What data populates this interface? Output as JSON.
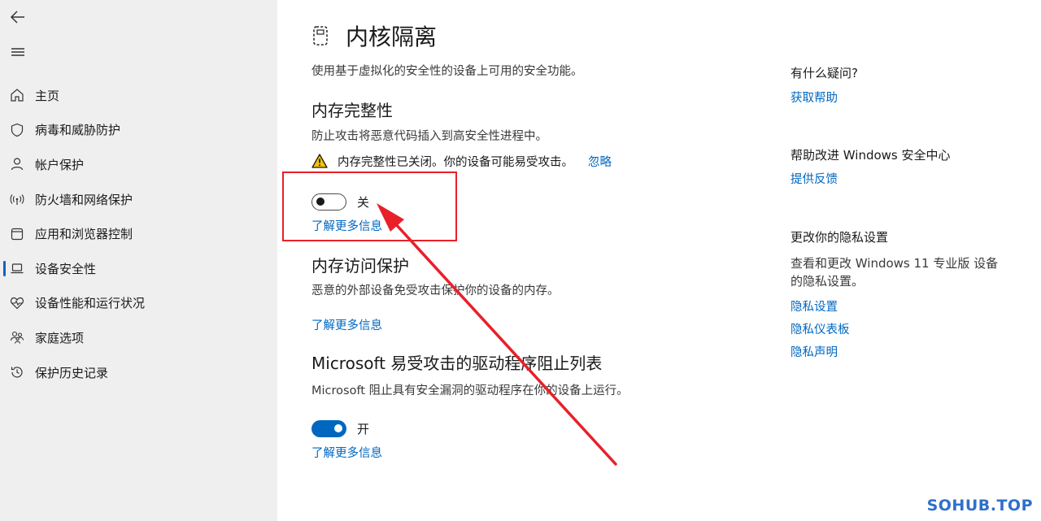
{
  "colors": {
    "accent": "#0067c0",
    "sidebar_bg": "#efefef",
    "annotation": "#e8202a"
  },
  "sidebar": {
    "back_icon": "back-arrow-icon",
    "menu_icon": "hamburger-menu-icon",
    "items": [
      {
        "label": "主页",
        "icon": "home-icon"
      },
      {
        "label": "病毒和威胁防护",
        "icon": "shield-icon"
      },
      {
        "label": "帐户保护",
        "icon": "person-icon"
      },
      {
        "label": "防火墙和网络保护",
        "icon": "wifi-antenna-icon"
      },
      {
        "label": "应用和浏览器控制",
        "icon": "app-window-icon"
      },
      {
        "label": "设备安全性",
        "icon": "laptop-icon"
      },
      {
        "label": "设备性能和运行状况",
        "icon": "heart-pulse-icon"
      },
      {
        "label": "家庭选项",
        "icon": "family-icon"
      },
      {
        "label": "保护历史记录",
        "icon": "history-icon"
      }
    ],
    "active_index": 5
  },
  "main": {
    "title": "内核隔离",
    "title_icon": "core-isolation-chip-icon",
    "description": "使用基于虚拟化的安全性的设备上可用的安全功能。",
    "memory_integrity": {
      "title": "内存完整性",
      "description": "防止攻击将恶意代码插入到高安全性进程中。",
      "warning_icon": "warning-triangle-icon",
      "warning": "内存完整性已关闭。你的设备可能易受攻击。",
      "ignore": "忽略",
      "toggle_state": "off",
      "toggle_label": "关",
      "learn_more": "了解更多信息"
    },
    "memory_access": {
      "title": "内存访问保护",
      "description": "恶意的外部设备免受攻击保护你的设备的内存。",
      "learn_more": "了解更多信息"
    },
    "driver_blocklist": {
      "title": "Microsoft 易受攻击的驱动程序阻止列表",
      "description": "Microsoft 阻止具有安全漏洞的驱动程序在你的设备上运行。",
      "toggle_state": "on",
      "toggle_label": "开",
      "learn_more": "了解更多信息"
    }
  },
  "aside": {
    "help_heading": "有什么疑问?",
    "help_link": "获取帮助",
    "feedback_heading": "帮助改进 Windows 安全中心",
    "feedback_link": "提供反馈",
    "privacy_heading": "更改你的隐私设置",
    "privacy_text": "查看和更改 Windows 11 专业版 设备的隐私设置。",
    "privacy_links": [
      "隐私设置",
      "隐私仪表板",
      "隐私声明"
    ]
  },
  "watermark": "SOHUB.TOP"
}
